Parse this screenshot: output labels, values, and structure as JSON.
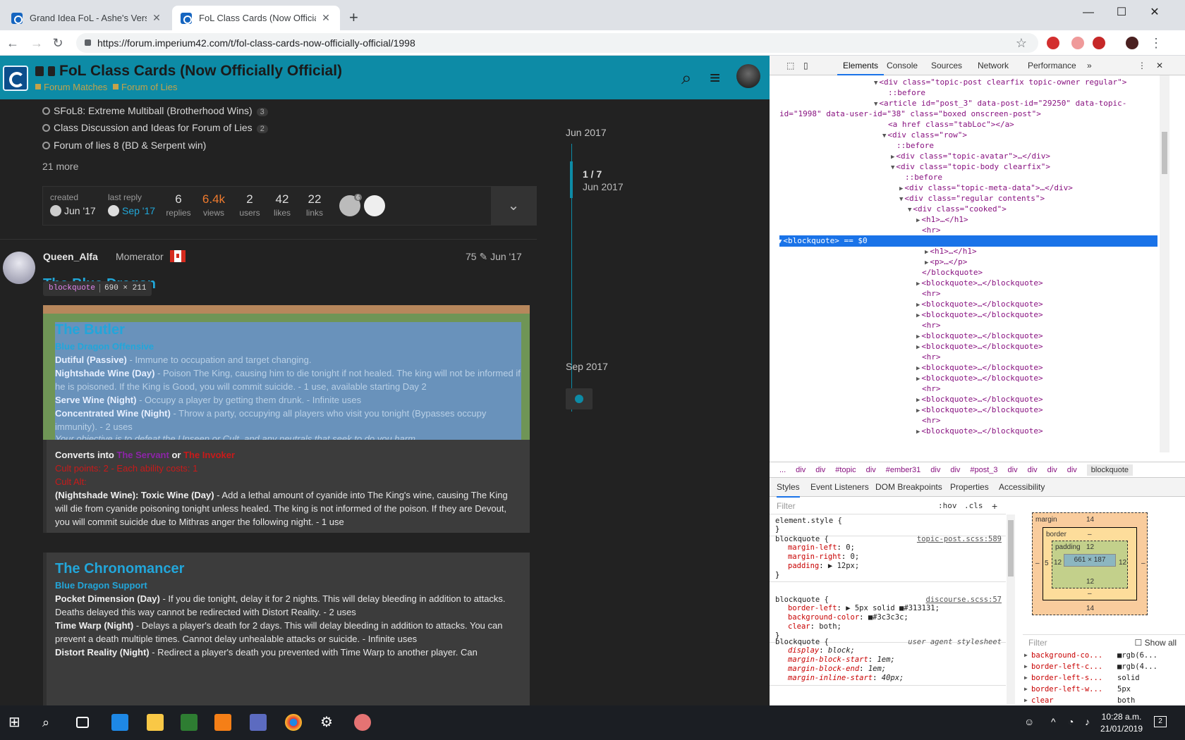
{
  "browser": {
    "tabs": [
      {
        "title": "Grand Idea FoL - Ashe's Version",
        "active": false
      },
      {
        "title": "FoL Class Cards (Now Officially O",
        "active": true
      }
    ],
    "new_tab": "+",
    "url": "https://forum.imperium42.com/t/fol-class-cards-now-officially-official/1998"
  },
  "site": {
    "topic_title": "FoL Class Cards (Now Officially Official)",
    "categories": [
      "Forum Matches",
      "Forum of Lies"
    ],
    "notifications": "1"
  },
  "related": [
    {
      "title": "SFoL8: Extreme Multiball (Brotherhood Wins)",
      "count": "3"
    },
    {
      "title": "Class Discussion and Ideas for Forum of Lies",
      "count": "2"
    },
    {
      "title": "Forum of lies 8 (BD & Serpent win)",
      "count": ""
    }
  ],
  "more_link": "21 more",
  "topic_map": {
    "created_label": "created",
    "created_date": "Jun '17",
    "last_reply_label": "last reply",
    "last_reply_date": "Sep '17",
    "stats": [
      {
        "value": "6",
        "label": "replies"
      },
      {
        "value": "6.4k",
        "label": "views"
      },
      {
        "value": "2",
        "label": "users"
      },
      {
        "value": "42",
        "label": "likes"
      },
      {
        "value": "22",
        "label": "links"
      }
    ],
    "participant_badge": "6"
  },
  "post": {
    "username": "Queen_Alfa",
    "user_title": "Momerator",
    "edit_count": "75",
    "date": "Jun '17",
    "heading": "The Blue Dragon"
  },
  "tooltip": {
    "tag": "blockquote",
    "size": "690 × 211"
  },
  "butler": {
    "title": "The Butler",
    "faction": "Blue Dragon Offensive",
    "abilities": [
      {
        "name": "Dutiful (Passive)",
        "text": " - Immune to occupation and target changing."
      },
      {
        "name": "Nightshade Wine (Day)",
        "text": " - Poison The King, causing him to die tonight if not healed. The king will not be informed if he is poisoned. If the King is Good, you will commit suicide. - 1 use, available starting Day 2"
      },
      {
        "name": "Serve Wine (Night)",
        "text": " - Occupy a player by getting them drunk. - Infinite uses"
      },
      {
        "name": "Concentrated Wine (Night)",
        "text": " - Throw a party, occupying all players who visit you tonight (Bypasses occupy immunity). - 2 uses"
      }
    ],
    "objective": "Your objective is to defeat the Unseen or Cult, and any neutrals that seek to do you harm."
  },
  "converts": {
    "prefix": "Converts into ",
    "servant": "The Servant",
    "or": " or ",
    "invoker": "The Invoker",
    "cult_points": "Cult points: 2 - Each ability costs: 1",
    "cult_alt": "Cult Alt:",
    "alt_name": "(Nightshade Wine): Toxic Wine (Day)",
    "alt_text": " - Add a lethal amount of cyanide into The King's wine, causing The King will die from cyanide poisoning tonight unless healed. The king is not informed of the poison. If they are Devout, you will commit suicide due to Mithras anger the following night. - 1 use"
  },
  "chronomancer": {
    "title": "The Chronomancer",
    "faction": "Blue Dragon Support",
    "abilities": [
      {
        "name": "Pocket Dimension (Day)",
        "text": " - If you die tonight, delay it for 2 nights. This will delay bleeding in addition to attacks. Deaths delayed this way cannot be redirected with Distort Reality. - 2 uses"
      },
      {
        "name": "Time Warp (Night)",
        "text": " - Delays a player's death for 2 days. This will delay bleeding in addition to attacks. You can prevent a death multiple times. Cannot delay unhealable attacks or suicide. - Infinite uses"
      },
      {
        "name": "Distort Reality (Night)",
        "text": " - Redirect a player's death you prevented with Time Warp to another player. Can"
      }
    ]
  },
  "timeline": {
    "start": "Jun 2017",
    "position": "1 / 7",
    "position_date": "Jun 2017",
    "end": "Sep 2017"
  },
  "devtools": {
    "tabs": [
      "Elements",
      "Console",
      "Sources",
      "Network",
      "Performance"
    ],
    "dom_lines": [
      {
        "i": 0,
        "t": "▼",
        "h": "<div class=\"topic-post clearfix topic-owner regular\">"
      },
      {
        "i": 1,
        "t": "",
        "h": "::before"
      },
      {
        "i": 0,
        "t": "▼",
        "h": "<article id=\"post_3\" data-post-id=\"29250\" data-topic-"
      },
      {
        "i": -1,
        "t": "",
        "h": "id=\"1998\" data-user-id=\"38\" class=\"boxed onscreen-post\">"
      },
      {
        "i": 1,
        "t": "",
        "h": "<a href class=\"tabLoc\"></a>"
      },
      {
        "i": 1,
        "t": "▼",
        "h": "<div class=\"row\">"
      },
      {
        "i": 2,
        "t": "",
        "h": "::before"
      },
      {
        "i": 2,
        "t": "▶",
        "h": "<div class=\"topic-avatar\">…</div>"
      },
      {
        "i": 2,
        "t": "▼",
        "h": "<div class=\"topic-body clearfix\">"
      },
      {
        "i": 3,
        "t": "",
        "h": "::before"
      },
      {
        "i": 3,
        "t": "▶",
        "h": "<div class=\"topic-meta-data\">…</div>"
      },
      {
        "i": 3,
        "t": "▼",
        "h": "<div class=\"regular contents\">"
      },
      {
        "i": 4,
        "t": "▼",
        "h": "<div class=\"cooked\">"
      },
      {
        "i": 5,
        "t": "▶",
        "h": "<h1>…</h1>"
      },
      {
        "i": 5,
        "t": "",
        "h": "<hr>"
      },
      {
        "i": 5,
        "t": "▼",
        "h": "<blockquote> == $0",
        "sel": true
      },
      {
        "i": 6,
        "t": "▶",
        "h": "<h1>…</h1>"
      },
      {
        "i": 6,
        "t": "▶",
        "h": "<p>…</p>"
      },
      {
        "i": 5,
        "t": "",
        "h": "</blockquote>"
      },
      {
        "i": 5,
        "t": "▶",
        "h": "<blockquote>…</blockquote>"
      },
      {
        "i": 5,
        "t": "",
        "h": "<hr>"
      },
      {
        "i": 5,
        "t": "▶",
        "h": "<blockquote>…</blockquote>"
      },
      {
        "i": 5,
        "t": "▶",
        "h": "<blockquote>…</blockquote>"
      },
      {
        "i": 5,
        "t": "",
        "h": "<hr>"
      },
      {
        "i": 5,
        "t": "▶",
        "h": "<blockquote>…</blockquote>"
      },
      {
        "i": 5,
        "t": "▶",
        "h": "<blockquote>…</blockquote>"
      },
      {
        "i": 5,
        "t": "",
        "h": "<hr>"
      },
      {
        "i": 5,
        "t": "▶",
        "h": "<blockquote>…</blockquote>"
      },
      {
        "i": 5,
        "t": "▶",
        "h": "<blockquote>…</blockquote>"
      },
      {
        "i": 5,
        "t": "",
        "h": "<hr>"
      },
      {
        "i": 5,
        "t": "▶",
        "h": "<blockquote>…</blockquote>"
      },
      {
        "i": 5,
        "t": "▶",
        "h": "<blockquote>…</blockquote>"
      },
      {
        "i": 5,
        "t": "",
        "h": "<hr>"
      },
      {
        "i": 5,
        "t": "▶",
        "h": "<blockquote>…</blockquote>"
      }
    ],
    "breadcrumbs": [
      "...",
      "div",
      "div",
      "#topic",
      "div",
      "#ember31",
      "div",
      "div",
      "#post_3",
      "div",
      "div",
      "div",
      "div",
      "blockquote"
    ],
    "sub_tabs": [
      "Styles",
      "Event Listeners",
      "DOM Breakpoints",
      "Properties",
      "Accessibility"
    ],
    "filter_placeholder": "Filter",
    "hov": ":hov",
    "cls": ".cls",
    "rules": [
      {
        "selector": "element.style {",
        "source": "",
        "props": [],
        "close": "}"
      },
      {
        "selector": "blockquote {",
        "source": "topic-post.scss:589",
        "props": [
          [
            "margin-left",
            "0;"
          ],
          [
            "margin-right",
            "0;"
          ],
          [
            "padding",
            "▶ 12px;"
          ]
        ],
        "close": "}"
      },
      {
        "selector": "blockquote {",
        "source": "discourse.scss:57",
        "props": [
          [
            "border-left",
            "▶ 5px solid ■#313131;"
          ],
          [
            "background-color",
            "■#3c3c3c;"
          ],
          [
            "clear",
            "both;"
          ]
        ],
        "close": "}"
      },
      {
        "selector": "blockquote {",
        "source": "user agent stylesheet",
        "ua": true,
        "props": [
          [
            "display",
            "block;"
          ],
          [
            "margin-block-start",
            "1em;"
          ],
          [
            "margin-block-end",
            "1em;"
          ],
          [
            "margin-inline-start",
            "40px;"
          ]
        ],
        "close": ""
      }
    ],
    "box_model": {
      "margin_label": "margin",
      "margin": "14",
      "border_label": "border",
      "border": "–",
      "padding_label": "padding",
      "padding": "12",
      "content": "661 × 187",
      "margin_side": "–",
      "border_side": "5"
    },
    "computed_filter": "Filter",
    "show_all": "Show all",
    "computed": [
      [
        "background-co...",
        "■rgb(6..."
      ],
      [
        "border-left-c...",
        "■rgb(4..."
      ],
      [
        "border-left-s...",
        "solid"
      ],
      [
        "border-left-w...",
        "5px"
      ],
      [
        "clear",
        "both"
      ]
    ]
  },
  "taskbar": {
    "time": "10:28 a.m.",
    "date": "21/01/2019",
    "notif_count": "2"
  }
}
